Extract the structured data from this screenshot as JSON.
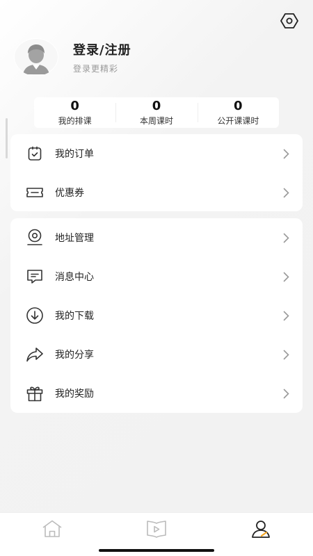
{
  "header": {
    "settings_icon": "hexagon-eye-settings-icon"
  },
  "profile": {
    "avatar_icon": "default-avatar-icon",
    "title": "登录/注册",
    "subtitle": "登录更精彩"
  },
  "stats": [
    {
      "value": "0",
      "label": "我的排课"
    },
    {
      "value": "0",
      "label": "本周课时"
    },
    {
      "value": "0",
      "label": "公开课课时"
    }
  ],
  "menu_group_1": [
    {
      "label": "我的订单",
      "icon": "order-clipboard-icon"
    },
    {
      "label": "优惠券",
      "icon": "coupon-ticket-icon"
    }
  ],
  "menu_group_2": [
    {
      "label": "地址管理",
      "icon": "location-pin-icon"
    },
    {
      "label": "消息中心",
      "icon": "message-bubble-icon"
    },
    {
      "label": "我的下载",
      "icon": "download-circle-icon"
    },
    {
      "label": "我的分享",
      "icon": "share-arrow-icon"
    },
    {
      "label": "我的奖励",
      "icon": "gift-box-icon"
    }
  ],
  "tabbar": [
    {
      "icon": "home-icon",
      "active": false
    },
    {
      "icon": "video-play-icon",
      "active": false
    },
    {
      "icon": "profile-icon",
      "active": true
    }
  ],
  "colors": {
    "accent": "#f5a623",
    "text": "#222222",
    "muted": "#999999",
    "icon": "#333333",
    "inactive_tab": "#bbbbbb"
  }
}
